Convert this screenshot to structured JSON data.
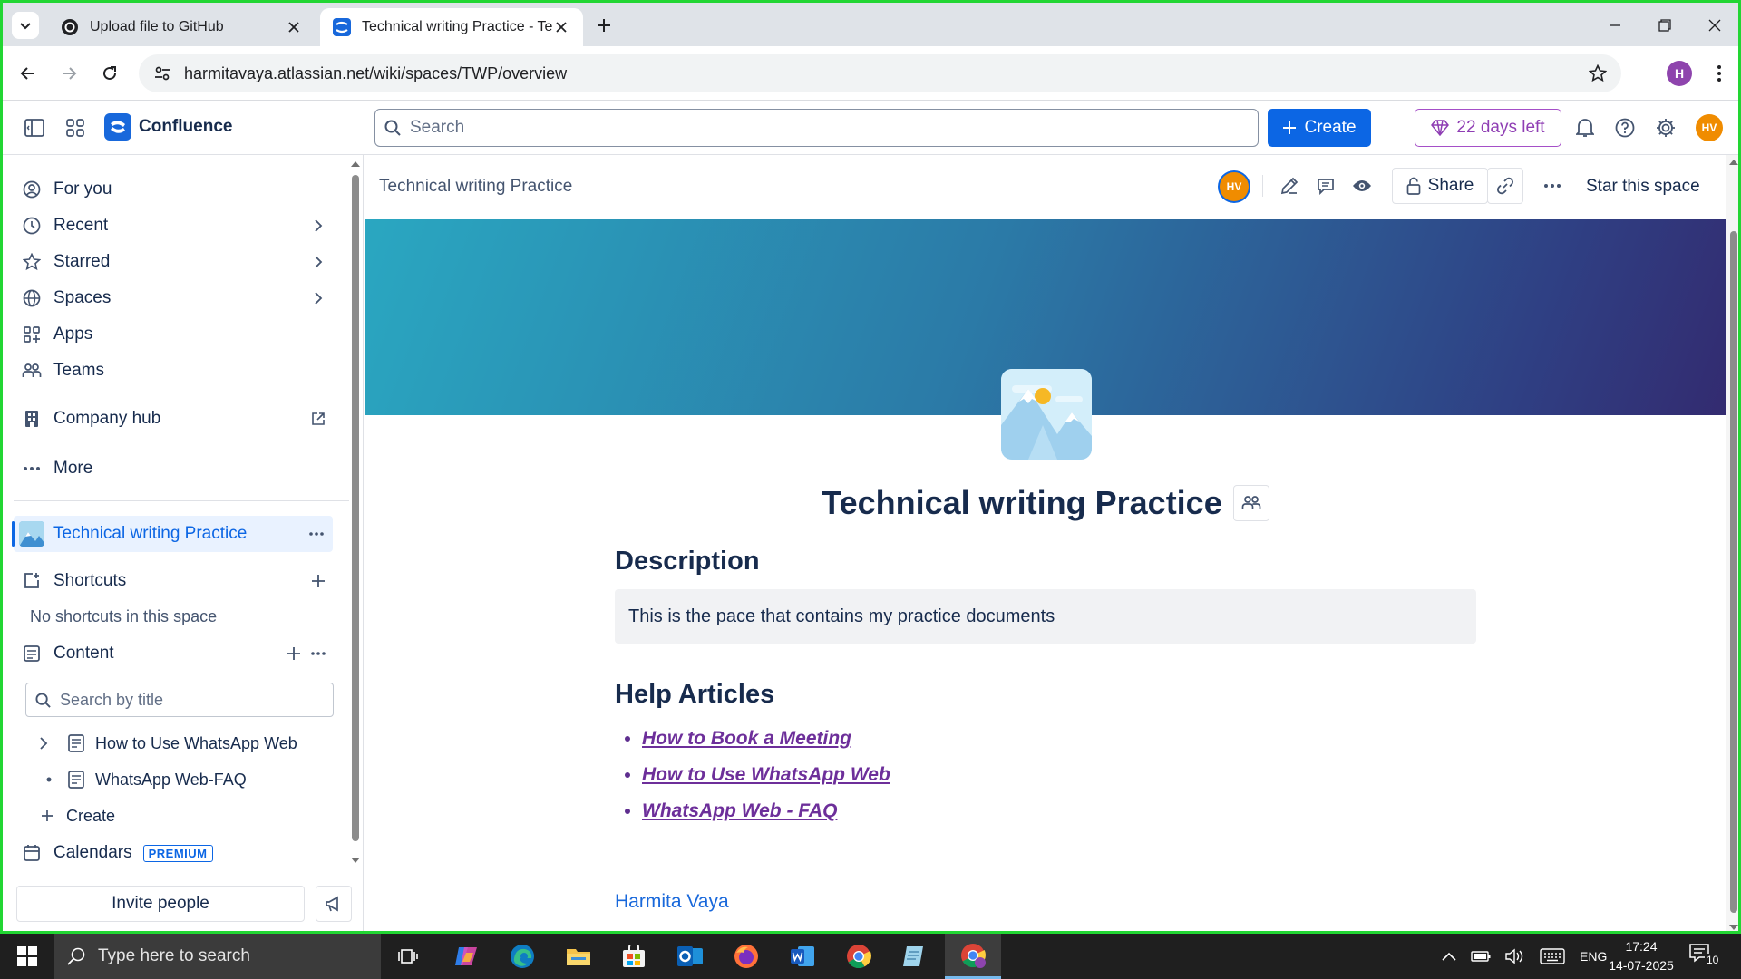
{
  "browser": {
    "tabs": [
      {
        "title": "Upload file to GitHub",
        "active": false
      },
      {
        "title": "Technical writing Practice - Technical writing Practice",
        "active": true
      }
    ],
    "url": "harmitavaya.atlassian.net/wiki/spaces/TWP/overview",
    "profile_initial": "H",
    "frame_color": "#22d633"
  },
  "topnav": {
    "brand": "Confluence",
    "search_placeholder": "Search",
    "create_label": "Create",
    "trial_label": "22 days left",
    "avatar_initials": "HV",
    "icons": [
      "sidebar-toggle-icon",
      "app-switcher-icon",
      "bell-icon",
      "help-icon",
      "gear-icon"
    ],
    "colors": {
      "primary": "#0c66e4",
      "trial": "#8f3eb4",
      "avatar": "#f08c00"
    }
  },
  "sidebar": {
    "nav": [
      {
        "label": "For you",
        "icon": "person-circle-icon",
        "chevron": false
      },
      {
        "label": "Recent",
        "icon": "clock-icon",
        "chevron": true
      },
      {
        "label": "Starred",
        "icon": "star-icon",
        "chevron": true
      },
      {
        "label": "Spaces",
        "icon": "globe-icon",
        "chevron": true
      },
      {
        "label": "Apps",
        "icon": "apps-icon",
        "chevron": false
      },
      {
        "label": "Teams",
        "icon": "people-icon",
        "chevron": false
      }
    ],
    "company_hub": "Company hub",
    "more": "More",
    "space_name": "Technical writing Practice",
    "shortcuts_label": "Shortcuts",
    "no_shortcuts": "No shortcuts in this space",
    "content_label": "Content",
    "title_search_placeholder": "Search by title",
    "tree": [
      {
        "label": "How to Use WhatsApp Web",
        "has_children": true
      },
      {
        "label": "WhatsApp Web-FAQ",
        "has_children": false
      }
    ],
    "create_label": "Create",
    "calendars_label": "Calendars",
    "premium_badge": "PREMIUM",
    "invite_label": "Invite people"
  },
  "page": {
    "breadcrumb": "Technical writing Practice",
    "avatar_initials": "HV",
    "share_label": "Share",
    "star_label": "Star this space",
    "title": "Technical writing Practice",
    "description_heading": "Description",
    "description_text": "This is the pace that contains my practice documents",
    "help_heading": "Help Articles",
    "help_links": [
      "How to Book a Meeting",
      "How to Use WhatsApp Web",
      "WhatsApp Web - FAQ"
    ],
    "author": "Harmita Vaya",
    "banner_colors": [
      "#2aa7c1",
      "#2b7aa7",
      "#2f3f83",
      "#332b70"
    ]
  },
  "taskbar": {
    "search_placeholder": "Type here to search",
    "language": "ENG",
    "time": "17:24",
    "date": "14-07-2025",
    "notification_count": "10",
    "apps": [
      "task-view-icon",
      "copilot-icon",
      "edge-icon",
      "file-explorer-icon",
      "store-icon",
      "outlook-icon",
      "firefox-icon",
      "word-icon",
      "chrome-icon",
      "notepad-icon",
      "chrome-profile-icon"
    ]
  }
}
